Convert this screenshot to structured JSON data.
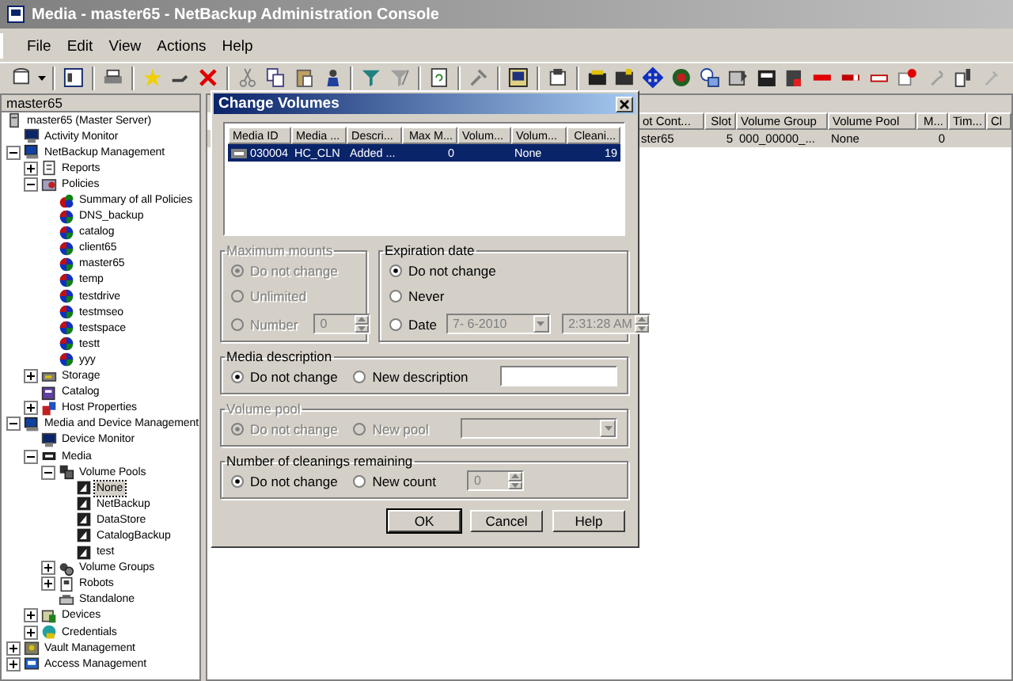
{
  "window": {
    "title": "Media - master65 - NetBackup Administration Console"
  },
  "menu": [
    "File",
    "Edit",
    "View",
    "Actions",
    "Help"
  ],
  "left_pane": {
    "header": "master65",
    "tree": [
      {
        "label": "master65 (Master Server)",
        "kind": "server",
        "selected": false,
        "children": [
          {
            "label": "Activity Monitor",
            "kind": "monitor",
            "selected": false
          },
          {
            "label": "NetBackup Management",
            "kind": "computer",
            "selected": false,
            "expanded": true,
            "children": [
              {
                "label": "Reports",
                "kind": "report",
                "selected": false,
                "expanded": false
              },
              {
                "label": "Policies",
                "kind": "folder",
                "selected": false,
                "expanded": true,
                "children": [
                  {
                    "label": "Summary of all Policies",
                    "kind": "summary",
                    "selected": false
                  },
                  {
                    "label": "DNS_backup",
                    "kind": "policy",
                    "selected": false
                  },
                  {
                    "label": "catalog",
                    "kind": "policy",
                    "selected": false
                  },
                  {
                    "label": "client65",
                    "kind": "policy",
                    "selected": false
                  },
                  {
                    "label": "master65",
                    "kind": "policy",
                    "selected": false
                  },
                  {
                    "label": "temp",
                    "kind": "policy",
                    "selected": false
                  },
                  {
                    "label": "testdrive",
                    "kind": "policy",
                    "selected": false
                  },
                  {
                    "label": "testmseo",
                    "kind": "policy",
                    "selected": false
                  },
                  {
                    "label": "testspace",
                    "kind": "policy",
                    "selected": false
                  },
                  {
                    "label": "testt",
                    "kind": "policy",
                    "selected": false
                  },
                  {
                    "label": "yyy",
                    "kind": "policy",
                    "selected": false
                  }
                ]
              },
              {
                "label": "Storage",
                "kind": "storage",
                "selected": false,
                "expanded": false
              },
              {
                "label": "Catalog",
                "kind": "catalog",
                "selected": false
              },
              {
                "label": "Host Properties",
                "kind": "host",
                "selected": false,
                "expanded": false
              }
            ]
          },
          {
            "label": "Media and Device Management",
            "kind": "computer",
            "selected": false,
            "expanded": true,
            "children": [
              {
                "label": "Device Monitor",
                "kind": "monitor",
                "selected": false
              },
              {
                "label": "Media",
                "kind": "media",
                "selected": false,
                "expanded": true,
                "children": [
                  {
                    "label": "Volume Pools",
                    "kind": "pools",
                    "selected": false,
                    "expanded": true,
                    "children": [
                      {
                        "label": "None",
                        "kind": "pool",
                        "selected": true
                      },
                      {
                        "label": "NetBackup",
                        "kind": "pool",
                        "selected": false
                      },
                      {
                        "label": "DataStore",
                        "kind": "pool",
                        "selected": false
                      },
                      {
                        "label": "CatalogBackup",
                        "kind": "pool",
                        "selected": false
                      },
                      {
                        "label": "test",
                        "kind": "pool",
                        "selected": false
                      }
                    ]
                  },
                  {
                    "label": "Volume Groups",
                    "kind": "groups",
                    "selected": false,
                    "expanded": false
                  },
                  {
                    "label": "Robots",
                    "kind": "robot",
                    "selected": false,
                    "expanded": false
                  },
                  {
                    "label": "Standalone",
                    "kind": "drive",
                    "selected": false
                  }
                ]
              },
              {
                "label": "Devices",
                "kind": "devices",
                "selected": false,
                "expanded": false
              },
              {
                "label": "Credentials",
                "kind": "credentials",
                "selected": false,
                "expanded": false
              }
            ]
          },
          {
            "label": "Vault Management",
            "kind": "vault",
            "selected": false,
            "expanded": false
          },
          {
            "label": "Access Management",
            "kind": "access",
            "selected": false,
            "expanded": false
          }
        ]
      }
    ]
  },
  "media_table": {
    "columns": [
      "ot Cont...",
      "Slot",
      "Volume Group",
      "Volume Pool",
      "M...",
      "Tim...",
      "Cl"
    ],
    "rows": [
      {
        "selected": true,
        "column_1": "ster65",
        "column_2": "5",
        "column_3": "000_00000_...",
        "column_4": "None",
        "column_5": "0"
      }
    ]
  },
  "dialog": {
    "title": "Change Volumes",
    "table": {
      "columns": [
        "Media ID",
        "Media ...",
        "Descri...",
        "Max M...",
        "Volum...",
        "Volum...",
        "Cleani..."
      ],
      "rows": [
        {
          "selected": true,
          "column_1": "030004",
          "column_2": "HC_CLN",
          "column_3": "Added ...",
          "column_4": "0",
          "column_6": "None",
          "column_7": "19"
        }
      ]
    },
    "groups": [
      {
        "title": "Maximum mounts",
        "kind": "stacked",
        "disabled": true,
        "options": [
          {
            "label": "Do not change",
            "selected": true
          },
          {
            "label": "Unlimited",
            "selected": false
          },
          {
            "label": "Number",
            "selected": false,
            "fields": [
              {
                "kind": "spin",
                "value": "0",
                "disabled": true
              }
            ]
          }
        ]
      },
      {
        "title": "Expiration date",
        "kind": "stacked",
        "disabled": false,
        "options": [
          {
            "label": "Do not change",
            "selected": true
          },
          {
            "label": "Never",
            "selected": false
          },
          {
            "label": "Date",
            "selected": false,
            "fields": [
              {
                "kind": "date",
                "value": "7- 6-2010",
                "disabled": true
              },
              {
                "kind": "time",
                "value": "2:31:28 AM",
                "disabled": true
              }
            ]
          }
        ]
      },
      {
        "title": "Media description",
        "kind": "inline",
        "disabled": false,
        "options": [
          {
            "label": "Do not change",
            "selected": true
          },
          {
            "label": "New description",
            "selected": false,
            "fields": [
              {
                "kind": "text",
                "disabled": false
              }
            ]
          }
        ]
      },
      {
        "title": "Volume pool",
        "kind": "inline",
        "disabled": true,
        "options": [
          {
            "label": "Do not change",
            "selected": true
          },
          {
            "label": "New pool",
            "selected": false,
            "fields": [
              {
                "kind": "dropdown",
                "disabled": true
              }
            ]
          }
        ]
      },
      {
        "title": "Number of cleanings remaining",
        "kind": "inline",
        "disabled": false,
        "options": [
          {
            "label": "Do not change",
            "selected": true
          },
          {
            "label": "New count",
            "selected": false,
            "fields": [
              {
                "kind": "spin",
                "value": "0",
                "disabled": true
              }
            ]
          }
        ]
      }
    ],
    "buttons": [
      {
        "label": "OK",
        "default": true
      },
      {
        "label": "Cancel",
        "default": false
      },
      {
        "label": "Help",
        "default": false
      }
    ]
  }
}
